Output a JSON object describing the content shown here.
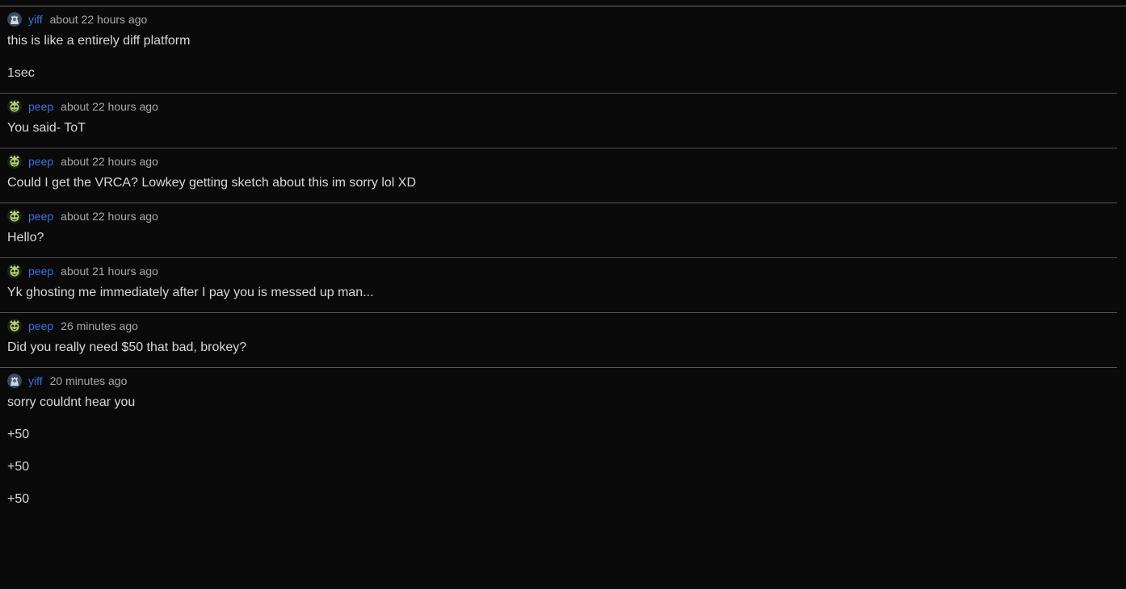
{
  "messages": [
    {
      "author": "yiff",
      "avatar": "yiff-avatar",
      "time": "about 22 hours ago",
      "lines": [
        "this is like a entirely diff platform",
        "1sec"
      ]
    },
    {
      "author": "peep",
      "avatar": "peep-avatar",
      "time": "about 22 hours ago",
      "lines": [
        "You said- ToT"
      ]
    },
    {
      "author": "peep",
      "avatar": "peep-avatar",
      "time": "about 22 hours ago",
      "lines": [
        "Could I get the VRCA? Lowkey getting sketch about this im sorry lol XD"
      ]
    },
    {
      "author": "peep",
      "avatar": "peep-avatar",
      "time": "about 22 hours ago",
      "lines": [
        "Hello?"
      ]
    },
    {
      "author": "peep",
      "avatar": "peep-avatar",
      "time": "about 21 hours ago",
      "lines": [
        "Yk ghosting me immediately after I pay you is messed up man..."
      ]
    },
    {
      "author": "peep",
      "avatar": "peep-avatar",
      "time": "26 minutes ago",
      "lines": [
        "Did you really need $50 that bad, brokey?"
      ]
    },
    {
      "author": "yiff",
      "avatar": "yiff-avatar",
      "time": "20 minutes ago",
      "lines": [
        "sorry couldnt hear you",
        "+50",
        "+50",
        "+50"
      ]
    }
  ],
  "colors": {
    "background": "#0a0a0b",
    "author_link": "#3f6fe0",
    "timestamp": "#a9a9a9",
    "text": "#d8d8d8",
    "divider": "#555557"
  }
}
